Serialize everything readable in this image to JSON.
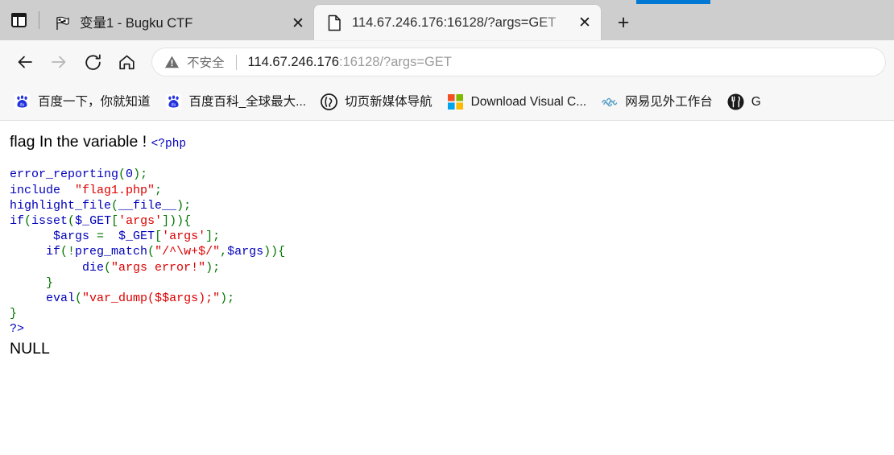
{
  "browser": {
    "tab_list_icon": "tab-list-icon",
    "new_tab_label": "+",
    "tabs": [
      {
        "title": "变量1 - Bugku CTF",
        "favicon": "checkered-flag-icon",
        "close_label": "✕",
        "active": false
      },
      {
        "title": "114.67.246.176:16128/?args=GET",
        "favicon": "document-page-icon",
        "close_label": "✕",
        "active": true
      }
    ],
    "nav": {
      "back_label": "←",
      "forward_label": "→",
      "reload_label": "reload-icon",
      "home_label": "home-icon"
    },
    "omnibox": {
      "security_icon": "warning-triangle-icon",
      "security_label": "不安全",
      "url_host": "114.67.246.176",
      "url_rest": ":16128/?args=GET",
      "url_full": "114.67.246.176:16128/?args=GET"
    },
    "bookmarks": [
      {
        "label": "百度一下，你就知道",
        "icon": "baidu-paw-icon"
      },
      {
        "label": "百度百科_全球最大...",
        "icon": "baidu-paw-icon"
      },
      {
        "label": "切页新媒体导航",
        "icon": "qieye-circle-icon"
      },
      {
        "label": "Download Visual C...",
        "icon": "microsoft-logo-icon"
      },
      {
        "label": "网易见外工作台",
        "icon": "netease-wave-icon"
      },
      {
        "label": "G",
        "icon": "fork-circle-icon"
      }
    ]
  },
  "page": {
    "heading": "flag In the variable !",
    "php_open_tag": "<?php",
    "php_close_tag": "?>",
    "output": "NULL",
    "code_lines": [
      {
        "indent": 0,
        "tokens": [
          {
            "t": "error_reporting",
            "c": "fn"
          },
          {
            "t": "(",
            "c": "kw"
          },
          {
            "t": "0",
            "c": "fn"
          },
          {
            "t": ");",
            "c": "kw"
          }
        ]
      },
      {
        "indent": 0,
        "tokens": [
          {
            "t": "include ",
            "c": "fn"
          },
          {
            "t": " \"flag1.php\"",
            "c": "str"
          },
          {
            "t": ";",
            "c": "kw"
          }
        ]
      },
      {
        "indent": 0,
        "tokens": [
          {
            "t": "highlight_file",
            "c": "fn"
          },
          {
            "t": "(",
            "c": "kw"
          },
          {
            "t": "__file__",
            "c": "fn"
          },
          {
            "t": ");",
            "c": "kw"
          }
        ]
      },
      {
        "indent": 0,
        "tokens": [
          {
            "t": "if",
            "c": "fn"
          },
          {
            "t": "(",
            "c": "kw"
          },
          {
            "t": "isset",
            "c": "fn"
          },
          {
            "t": "(",
            "c": "kw"
          },
          {
            "t": "$_GET",
            "c": "fn"
          },
          {
            "t": "[",
            "c": "kw"
          },
          {
            "t": "'args'",
            "c": "str"
          },
          {
            "t": "])){",
            "c": "kw"
          }
        ]
      },
      {
        "indent": 6,
        "tokens": [
          {
            "t": "$args",
            "c": "fn"
          },
          {
            "t": " = ",
            "c": "kw"
          },
          {
            "t": " $_GET",
            "c": "fn"
          },
          {
            "t": "[",
            "c": "kw"
          },
          {
            "t": "'args'",
            "c": "str"
          },
          {
            "t": "];",
            "c": "kw"
          }
        ]
      },
      {
        "indent": 5,
        "tokens": [
          {
            "t": "if",
            "c": "fn"
          },
          {
            "t": "(!",
            "c": "kw"
          },
          {
            "t": "preg_match",
            "c": "fn"
          },
          {
            "t": "(",
            "c": "kw"
          },
          {
            "t": "\"/^\\w+$/\"",
            "c": "str"
          },
          {
            "t": ",",
            "c": "kw"
          },
          {
            "t": "$args",
            "c": "fn"
          },
          {
            "t": ")){",
            "c": "kw"
          }
        ]
      },
      {
        "indent": 10,
        "tokens": [
          {
            "t": "die",
            "c": "fn"
          },
          {
            "t": "(",
            "c": "kw"
          },
          {
            "t": "\"args error!\"",
            "c": "str"
          },
          {
            "t": ");",
            "c": "kw"
          }
        ]
      },
      {
        "indent": 5,
        "tokens": [
          {
            "t": "}",
            "c": "kw"
          }
        ]
      },
      {
        "indent": 5,
        "tokens": [
          {
            "t": "eval",
            "c": "fn"
          },
          {
            "t": "(",
            "c": "kw"
          },
          {
            "t": "\"var_dump($$args);\"",
            "c": "str"
          },
          {
            "t": ");",
            "c": "kw"
          }
        ]
      },
      {
        "indent": 0,
        "tokens": [
          {
            "t": "}",
            "c": "kw"
          }
        ]
      }
    ]
  },
  "colors": {
    "php_blue": "#0000bb",
    "php_red": "#dd0000",
    "php_green": "#007700",
    "accent_blue": "#0078d4",
    "tabstrip_bg": "#cecece",
    "chrome_bg": "#f7f7f7"
  }
}
